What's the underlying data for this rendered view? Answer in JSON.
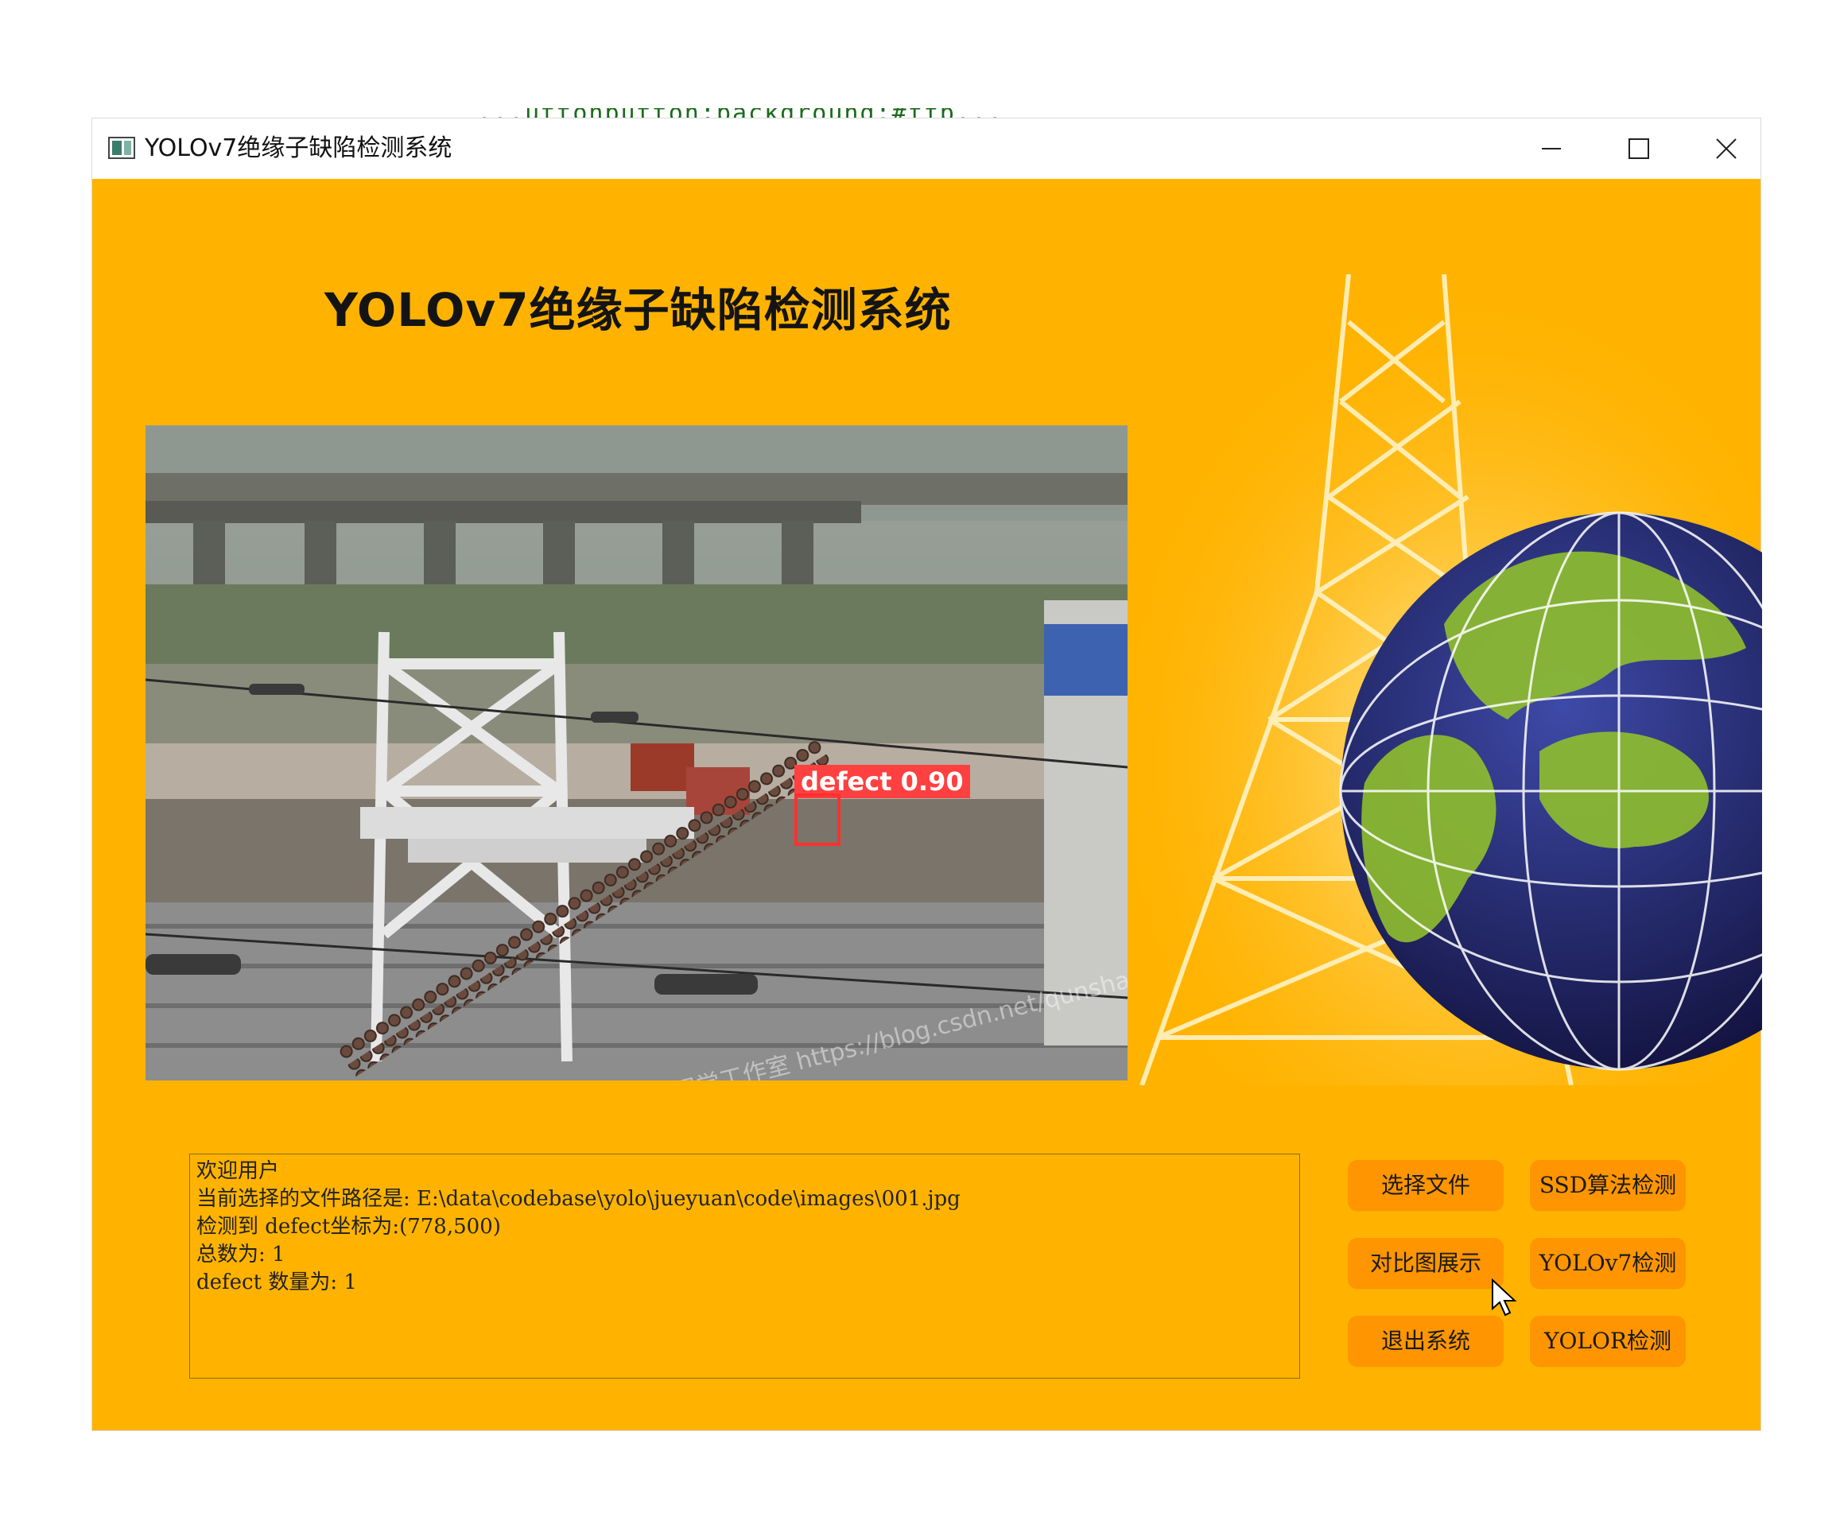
{
  "background_code_snippet": "...uttonbutton;background:#ffb...",
  "window": {
    "title": "YOLOv7绝缘子缺陷检测系统",
    "controls": [
      "minimize-icon",
      "maximize-icon",
      "close-icon"
    ]
  },
  "app": {
    "heading": "YOLOv7绝缘子缺陷检测系统",
    "accent_color": "#ffb300",
    "button_color": "#ff9500"
  },
  "detection": {
    "label": "defect 0.90",
    "box_color": "#ff3030"
  },
  "watermark": "群马视觉工作室 https://blog.csdn.net/qunshan_.../",
  "log": {
    "lines": [
      "欢迎用户",
      "当前选择的文件路径是: E:\\data\\codebase\\yolo\\jueyuan\\code\\images\\001.jpg",
      "检测到 defect坐标为:(778,500)",
      "总数为: 1",
      "defect 数量为: 1"
    ]
  },
  "buttons": {
    "select_file": "选择文件",
    "ssd_detect": "SSD算法检测",
    "compare_view": "对比图展示",
    "yolov7_detect": "YOLOv7检测",
    "exit_system": "退出系统",
    "yolor_detect": "YOLOR检测"
  }
}
